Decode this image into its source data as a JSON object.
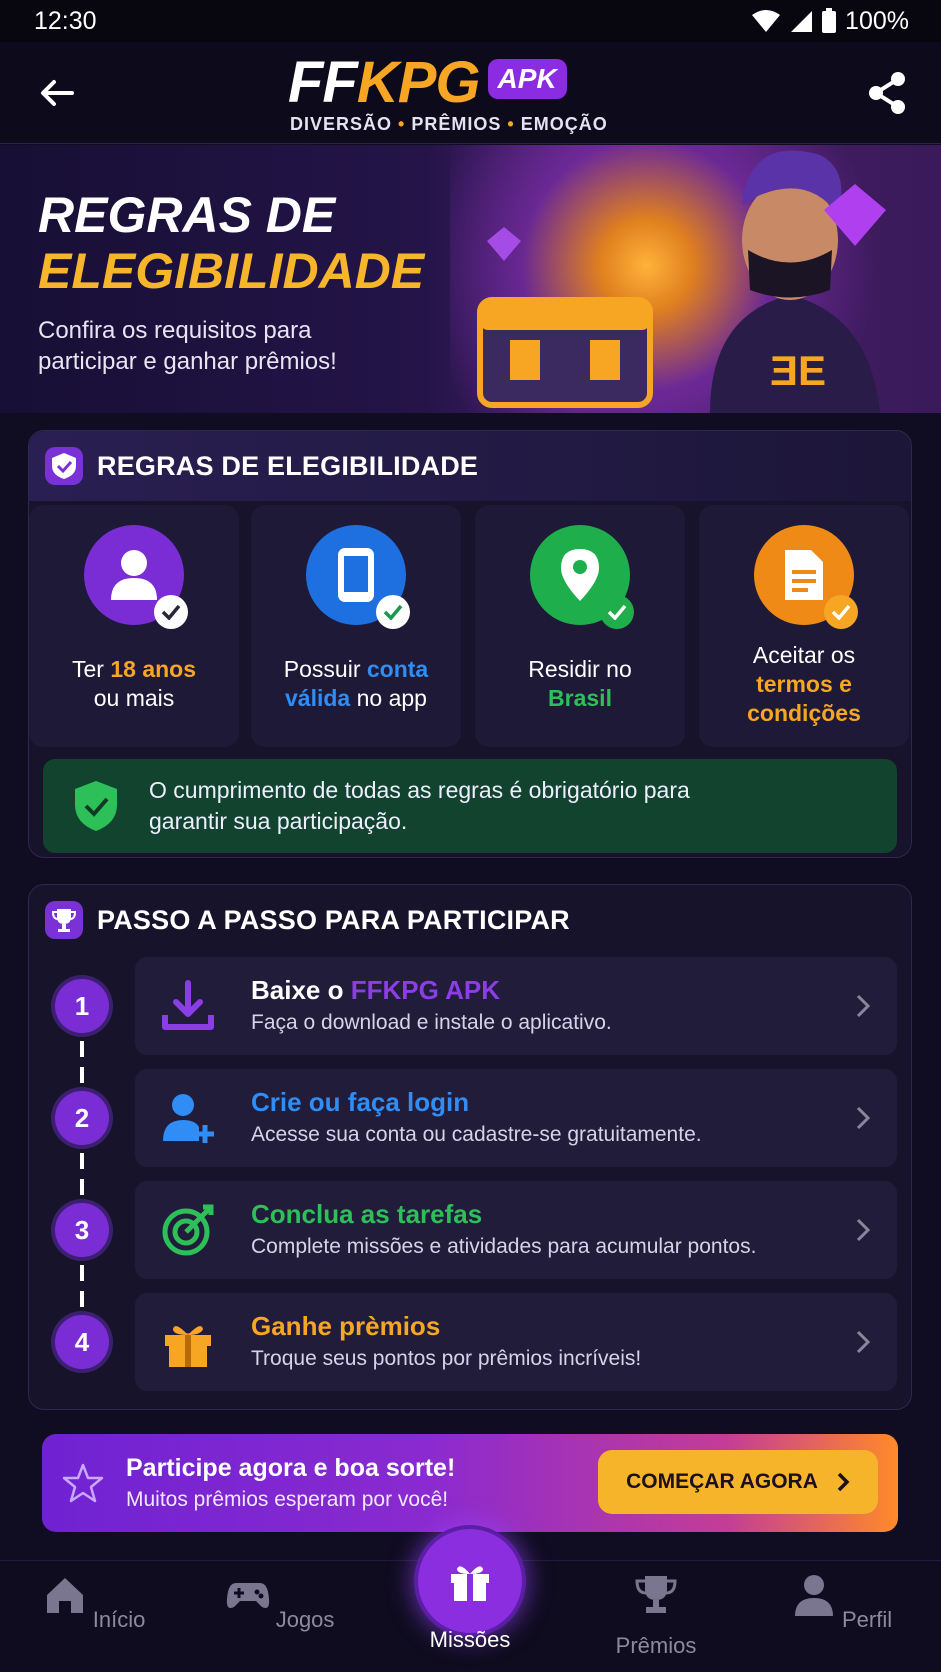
{
  "status_bar": {
    "time": "12:30",
    "battery": "100%"
  },
  "header": {
    "logo_ff": "FF",
    "logo_kpg": "KPG",
    "logo_badge": "APK",
    "tagline_1": "DIVERSÃO",
    "tagline_2": "PRÊMIOS",
    "tagline_3": "EMOÇÃO",
    "back_icon": "arrow-left-icon",
    "share_icon": "share-icon"
  },
  "hero": {
    "title_line1": "REGRAS DE",
    "title_line2": "ELEGIBILIDADE",
    "subtitle": "Confira os requisitos para participar e ganhar prêmios!"
  },
  "rules": {
    "title": "REGRAS DE ELEGIBILIDADE",
    "items": [
      {
        "pre": "Ter ",
        "highlight": "18 anos",
        "post": "ou mais",
        "color": "#f6a623",
        "icon": "user-icon"
      },
      {
        "pre": "Possuir ",
        "highlight1": "conta",
        "highlight2": "válida",
        "post": " no app",
        "color": "#2f8df5",
        "icon": "phone-icon"
      },
      {
        "pre": "Residir no",
        "highlight": "Brasil",
        "color": "#2dbf58",
        "icon": "location-pin-icon"
      },
      {
        "pre": "Aceitar os",
        "highlight1": "termos e",
        "highlight2": "condições",
        "color": "#f6a623",
        "icon": "document-icon"
      }
    ],
    "notice": "O cumprimento de todas as regras é obrigatório para garantir sua participação."
  },
  "steps": {
    "title": "PASSO A PASSO PARA PARTICIPAR",
    "items": [
      {
        "num": "1",
        "title_pre": "Baixe o ",
        "title_hl": "FFKPG APK",
        "desc": "Faça o download e instale o aplicativo.",
        "color": "#8b3de6",
        "icon": "download-icon"
      },
      {
        "num": "2",
        "title": "Crie ou faça login",
        "desc": "Acesse sua conta ou cadastre-se gratuitamente.",
        "color": "#2f8df5",
        "icon": "add-user-icon"
      },
      {
        "num": "3",
        "title": "Conclua as tarefas",
        "desc": "Complete missões e atividades para acumular pontos.",
        "color": "#2dbf58",
        "icon": "target-icon"
      },
      {
        "num": "4",
        "title": "Ganhe prèmios",
        "desc": "Troque seus pontos por prêmios incríveis!",
        "color": "#f6a623",
        "icon": "gift-icon"
      }
    ]
  },
  "cta": {
    "heading": "Participe agora e boa sorte!",
    "sub": "Muitos prêmios esperam por você!",
    "button": "COMEÇAR AGORA"
  },
  "nav": {
    "items": [
      {
        "label": "Início",
        "icon": "home-icon"
      },
      {
        "label": "Jogos",
        "icon": "gamepad-icon"
      },
      {
        "label": "Missões",
        "icon": "gift-icon",
        "active": true
      },
      {
        "label": "Prêmios",
        "icon": "trophy-icon"
      },
      {
        "label": "Perfil",
        "icon": "user-icon"
      }
    ]
  }
}
